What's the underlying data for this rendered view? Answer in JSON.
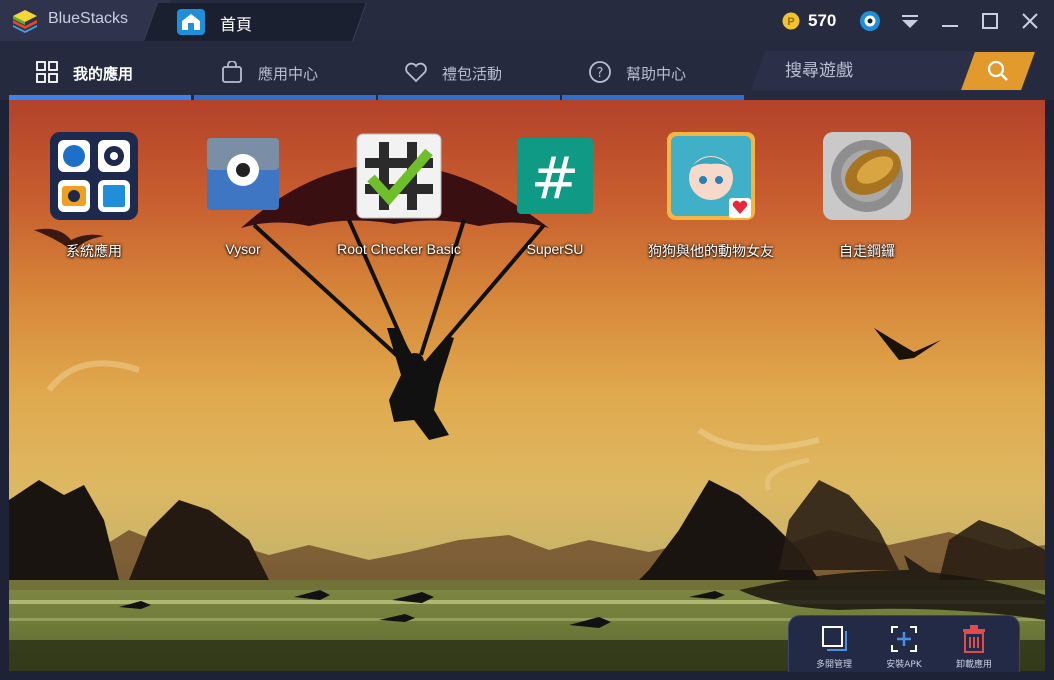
{
  "titlebar": {
    "brand_name": "BlueStacks",
    "home_tab_label": "首頁",
    "coins": "570",
    "colors": {
      "brand_green": "#5fb02f",
      "accent_blue": "#1e8fd8",
      "coin_gold": "#f1c232"
    }
  },
  "nav": {
    "tabs": [
      {
        "label": "我的應用",
        "icon": "grid-icon",
        "active": true
      },
      {
        "label": "應用中心",
        "icon": "bag-icon",
        "active": false
      },
      {
        "label": "禮包活動",
        "icon": "heart-icon",
        "active": false
      },
      {
        "label": "幫助中心",
        "icon": "question-icon",
        "active": false
      }
    ],
    "search_placeholder": "搜尋遊戲",
    "search_icon": "search-icon",
    "search_color": "#e39a2d"
  },
  "apps": [
    {
      "label": "系統應用",
      "icon": "system-apps-icon"
    },
    {
      "label": "Vysor",
      "icon": "vysor-icon"
    },
    {
      "label": "Root Checker Basic",
      "icon": "root-checker-icon"
    },
    {
      "label": "SuperSU",
      "icon": "supersu-icon"
    },
    {
      "label": "狗狗與他的動物女友",
      "icon": "anime-game-icon"
    },
    {
      "label": "自走鋼鑼",
      "icon": "gear-shell-icon"
    }
  ],
  "toolbar": {
    "items": [
      {
        "label": "多開管理",
        "icon": "multi-instance-icon"
      },
      {
        "label": "安裝APK",
        "icon": "install-apk-icon"
      },
      {
        "label": "卸載應用",
        "icon": "trash-icon"
      }
    ]
  }
}
